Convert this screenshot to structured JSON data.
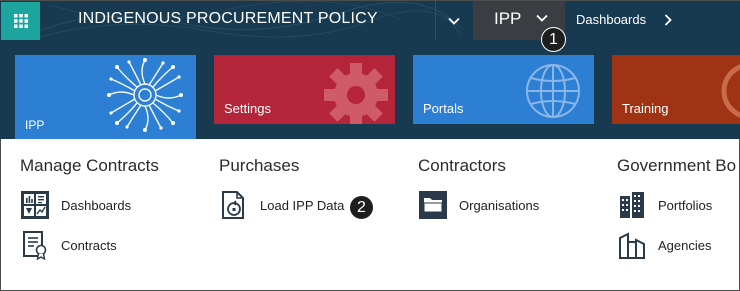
{
  "header": {
    "app_title": "INDIGENOUS PROCUREMENT POLICY",
    "area": "IPP",
    "breadcrumb": "Dashboards"
  },
  "tiles": [
    {
      "label": "IPP",
      "color": "#2d7fd4"
    },
    {
      "label": "Settings",
      "color": "#b5253a"
    },
    {
      "label": "Portals",
      "color": "#2d7fd4"
    },
    {
      "label": "Training",
      "color": "#a13315"
    }
  ],
  "columns": [
    {
      "heading": "Manage Contracts",
      "items": [
        {
          "label": "Dashboards",
          "icon": "dashboard-icon"
        },
        {
          "label": "Contracts",
          "icon": "contract-icon"
        }
      ]
    },
    {
      "heading": "Purchases",
      "items": [
        {
          "label": "Load IPP Data",
          "icon": "load-data-icon"
        }
      ]
    },
    {
      "heading": "Contractors",
      "items": [
        {
          "label": "Organisations",
          "icon": "organisation-icon"
        }
      ]
    },
    {
      "heading": "Government Bo",
      "items": [
        {
          "label": "Portfolios",
          "icon": "portfolio-icon"
        },
        {
          "label": "Agencies",
          "icon": "agency-icon"
        }
      ]
    }
  ],
  "callouts": [
    "1",
    "2"
  ],
  "colors": {
    "nav_bg": "#173a51",
    "launcher": "#1ba59e",
    "area_selector": "#3a3d41",
    "badge": "#1e1e1e"
  }
}
